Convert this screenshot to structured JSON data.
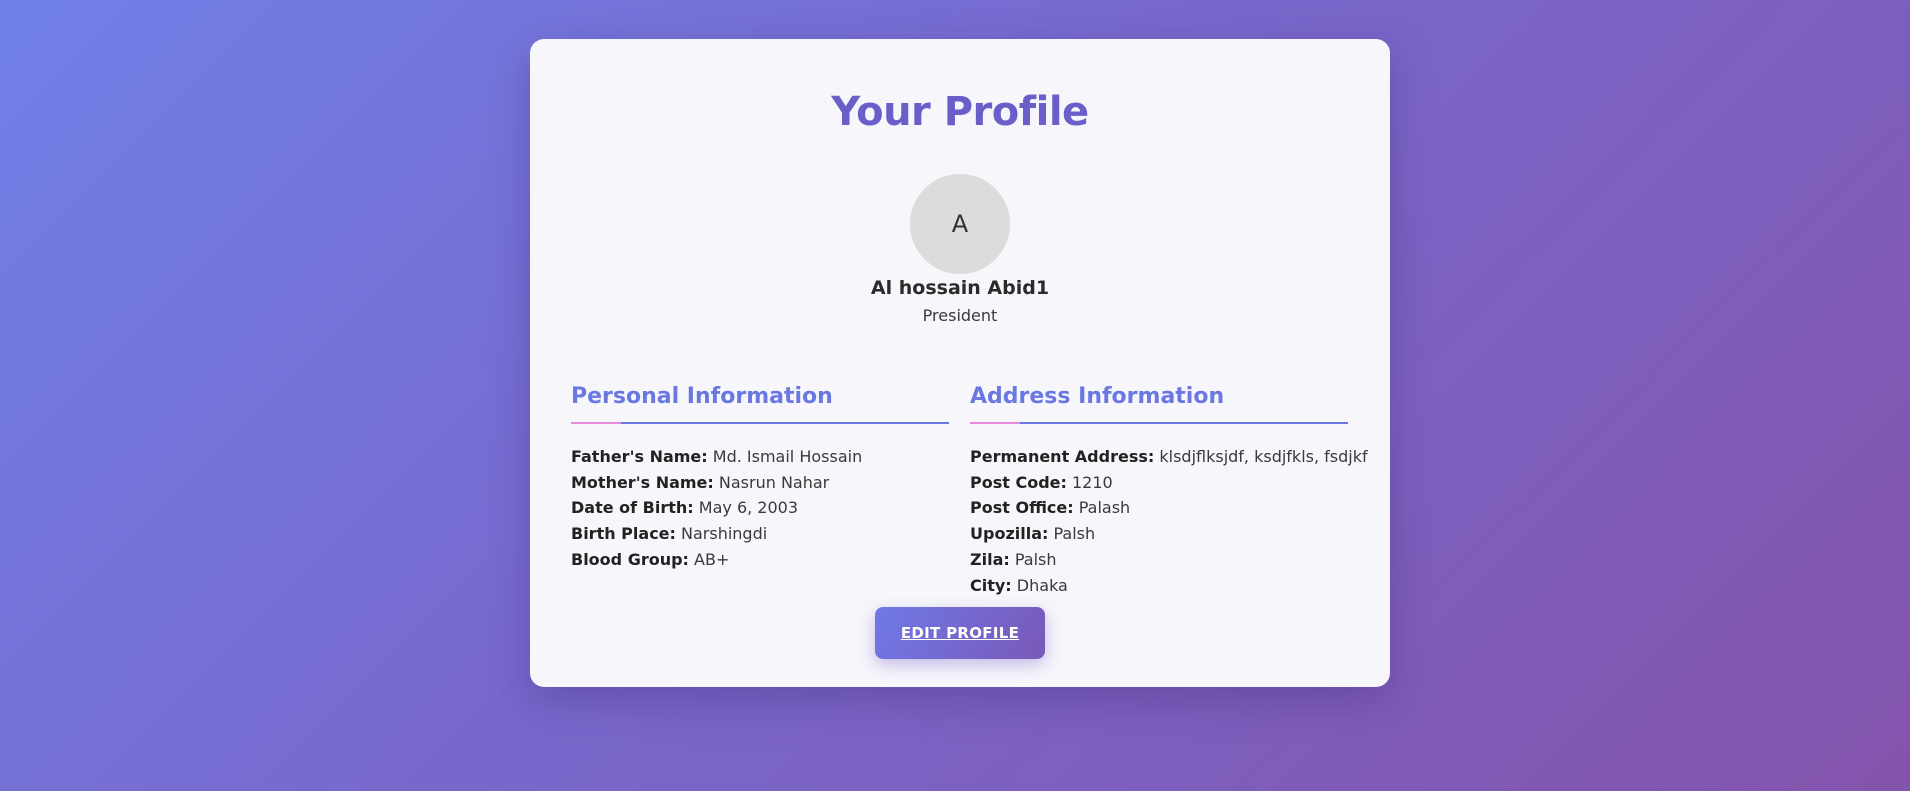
{
  "page": {
    "title": "Your Profile"
  },
  "profile": {
    "avatar_initial": "A",
    "name": "Al hossain Abid1",
    "role": "President"
  },
  "personal": {
    "title": "Personal Information",
    "rows": [
      {
        "label": "Father's Name:",
        "value": "Md. Ismail Hossain"
      },
      {
        "label": "Mother's Name:",
        "value": "Nasrun Nahar"
      },
      {
        "label": "Date of Birth:",
        "value": "May 6, 2003"
      },
      {
        "label": "Birth Place:",
        "value": "Narshingdi"
      },
      {
        "label": "Blood Group:",
        "value": "AB+"
      }
    ]
  },
  "address": {
    "title": "Address Information",
    "rows": [
      {
        "label": "Permanent Address:",
        "value": "klsdjflksjdf, ksdjfkls, fsdjkf"
      },
      {
        "label": "Post Code:",
        "value": "1210"
      },
      {
        "label": "Post Office:",
        "value": "Palash"
      },
      {
        "label": "Upozilla:",
        "value": "Palsh"
      },
      {
        "label": "Zila:",
        "value": "Palsh"
      },
      {
        "label": "City:",
        "value": "Dhaka"
      }
    ]
  },
  "actions": {
    "edit_label": "EDIT PROFILE"
  },
  "colors": {
    "accent": "#6b78e2",
    "title": "#6a5fc8",
    "rule_highlight": "#e58ad8",
    "button_start": "#6f79e6",
    "button_end": "#7a58b8"
  }
}
